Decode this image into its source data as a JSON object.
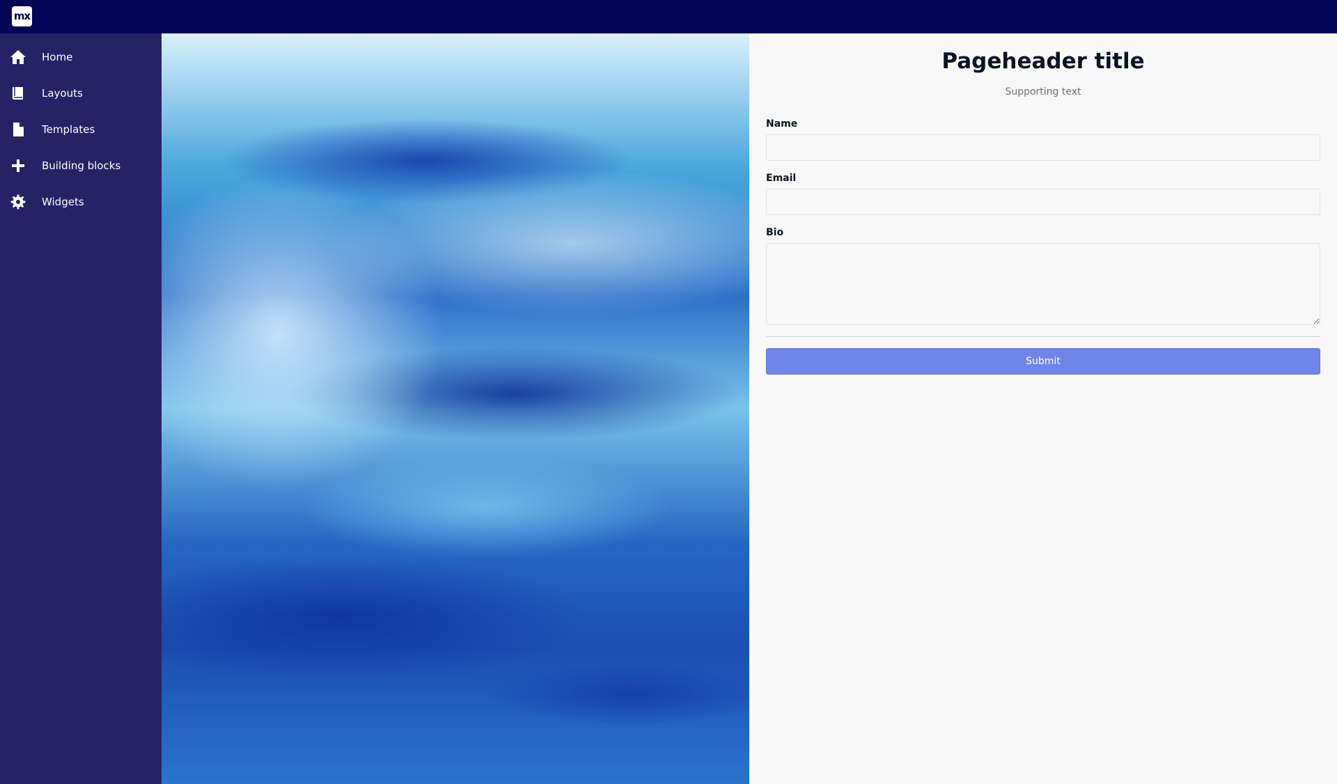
{
  "app": {
    "logo_text": "mx",
    "topbar_color": "#020557",
    "sidebar_color": "#252265"
  },
  "sidebar": {
    "items": [
      {
        "label": "Home",
        "icon": "home-icon"
      },
      {
        "label": "Layouts",
        "icon": "book-icon"
      },
      {
        "label": "Templates",
        "icon": "file-icon"
      },
      {
        "label": "Building blocks",
        "icon": "plus-icon"
      },
      {
        "label": "Widgets",
        "icon": "gear-icon"
      }
    ]
  },
  "hero": {
    "image": "ocean-waves-image"
  },
  "header": {
    "title": "Pageheader title",
    "subtitle": "Supporting text"
  },
  "form": {
    "name_label": "Name",
    "name_value": "",
    "email_label": "Email",
    "email_value": "",
    "bio_label": "Bio",
    "bio_value": "",
    "submit_label": "Submit",
    "submit_color": "#7085e9"
  }
}
